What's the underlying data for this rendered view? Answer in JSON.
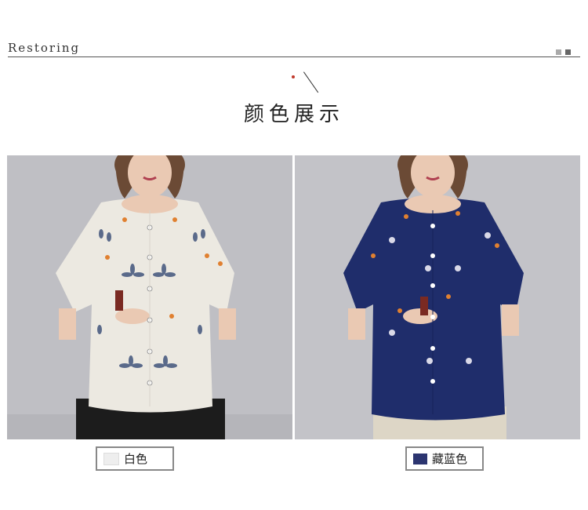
{
  "header": {
    "brand": "Restoring",
    "title": "颜色展示",
    "squares": [
      "#aaaaaa",
      "#666666"
    ]
  },
  "colors": {
    "accent_dot": "#c0392b"
  },
  "products": [
    {
      "label": "白色",
      "swatch_color": "#eeeeee",
      "shirt_color": "#ece9e1"
    },
    {
      "label": "藏蓝色",
      "swatch_color": "#2c3570",
      "shirt_color": "#1f2d6b"
    }
  ]
}
